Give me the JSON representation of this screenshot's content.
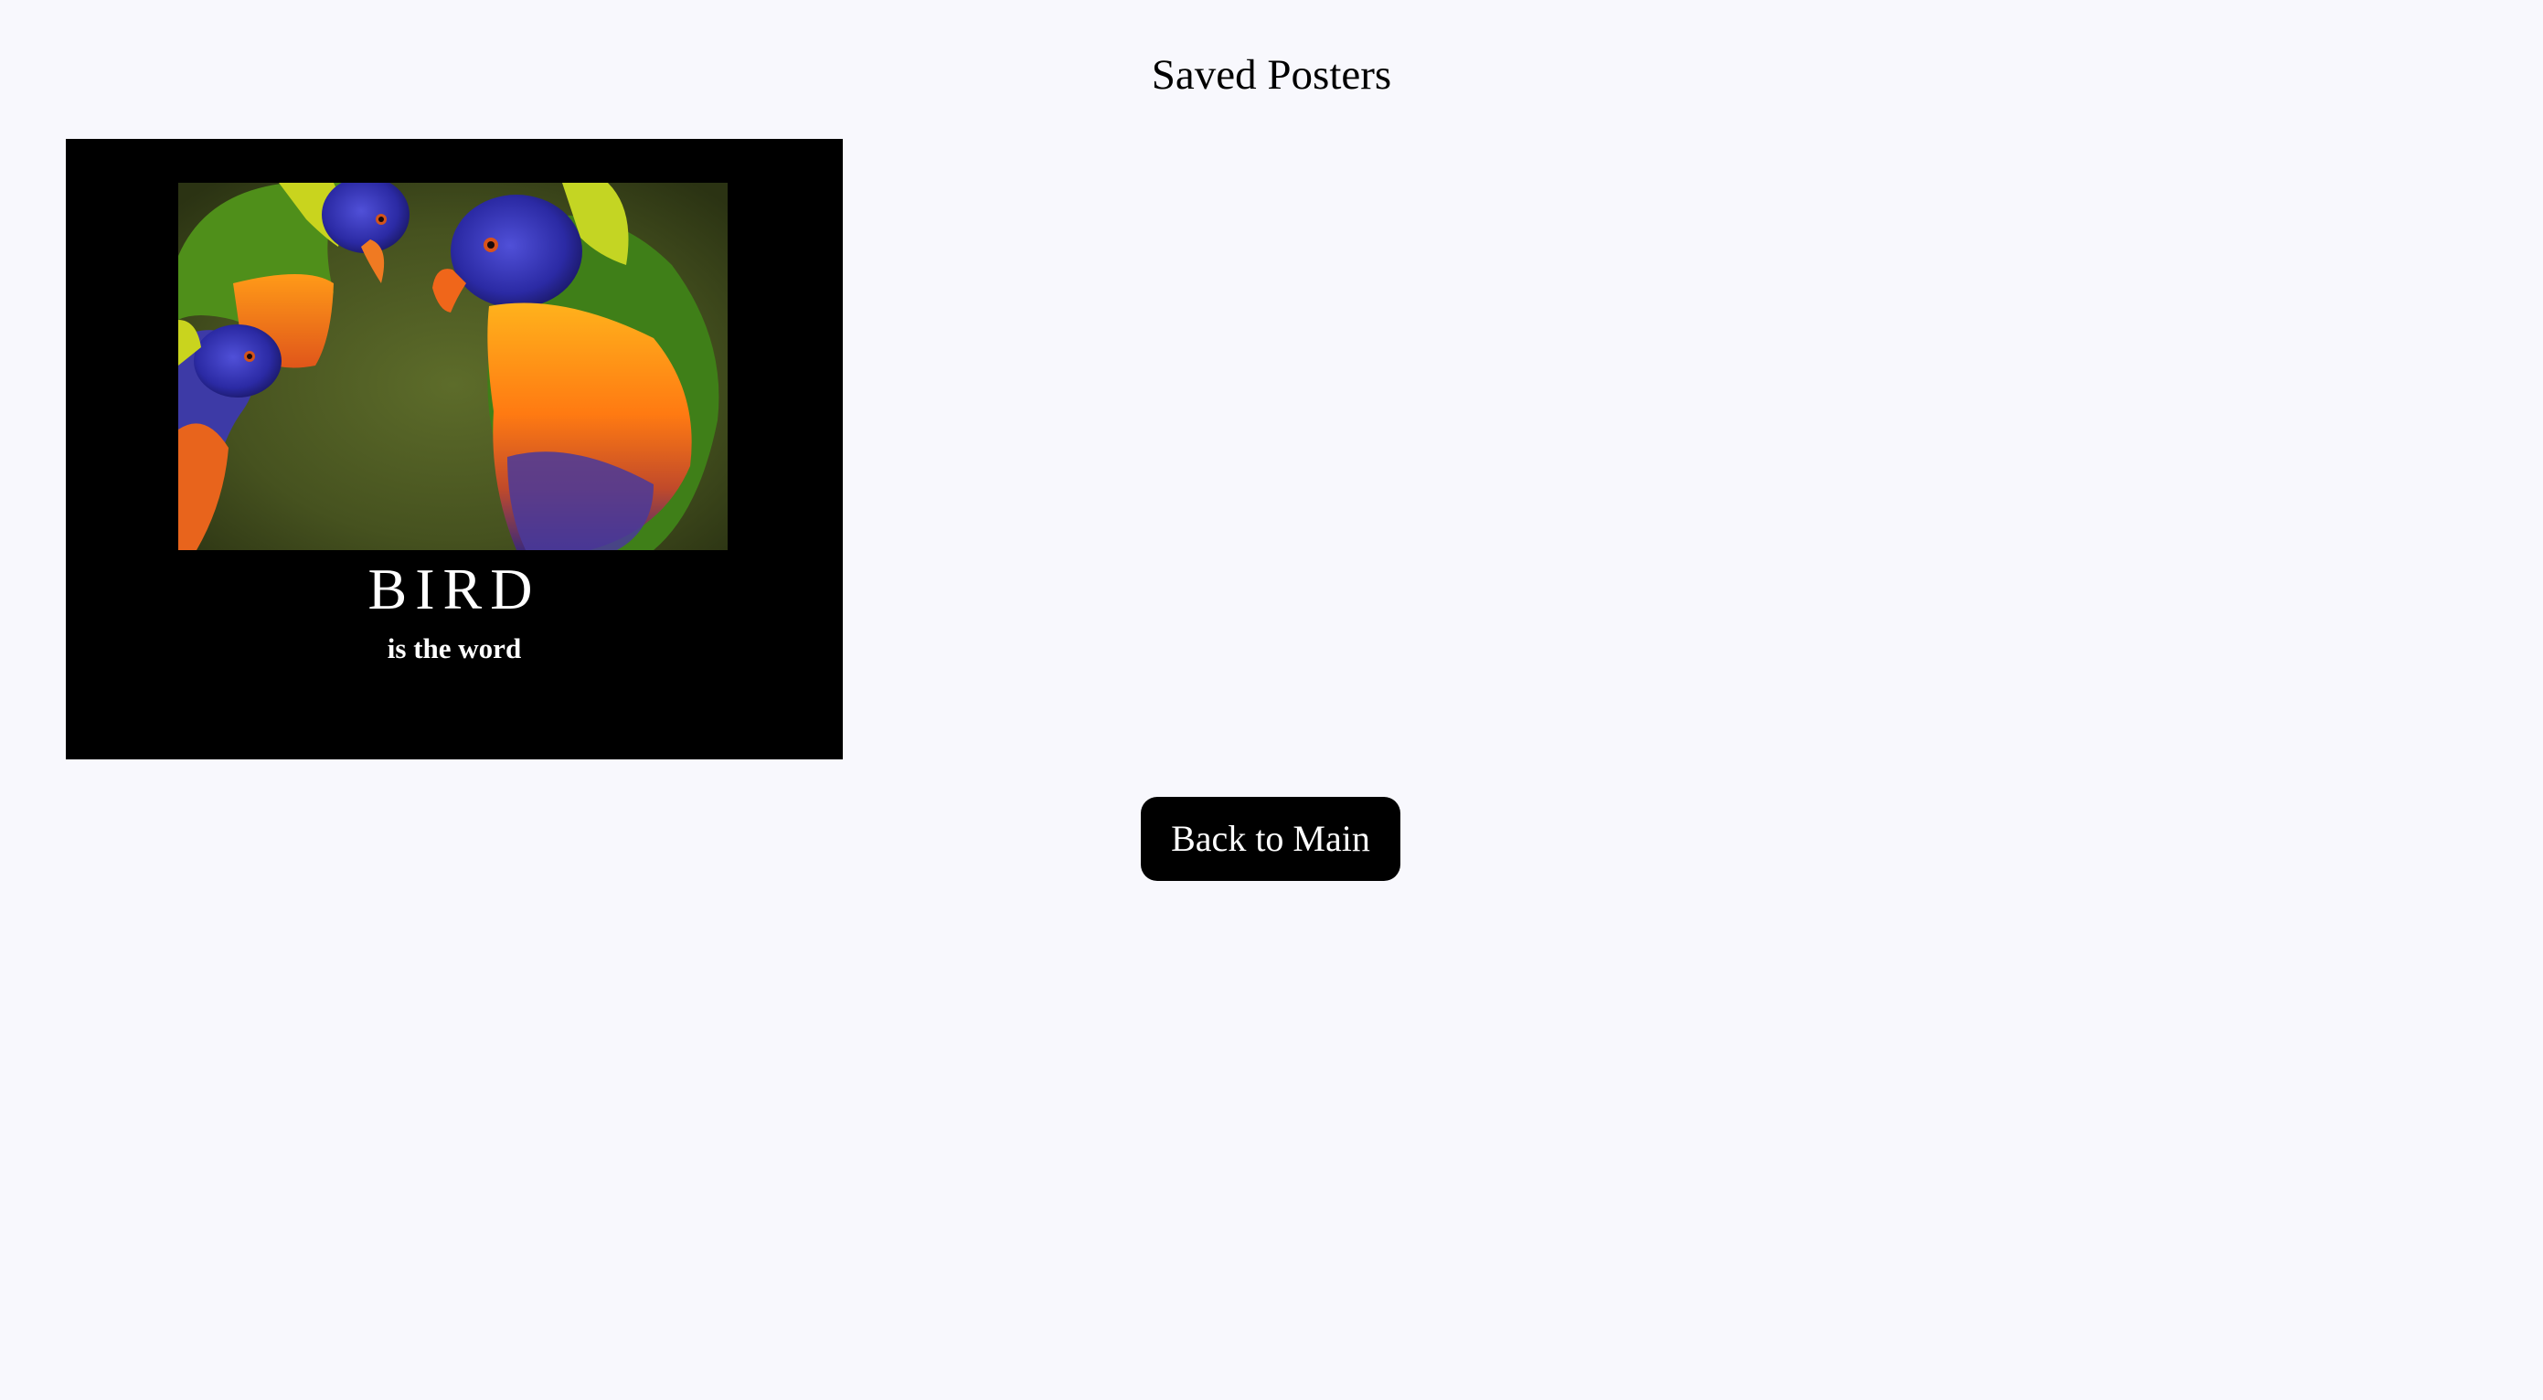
{
  "page": {
    "title": "Saved Posters"
  },
  "saved_posters": [
    {
      "title": "BIRD",
      "quote": "is the word",
      "image_subject": "rainbow lorikeets"
    }
  ],
  "actions": {
    "back_button_label": "Back to Main"
  },
  "colors": {
    "page_background": "#f8f8fd",
    "poster_background": "#000000",
    "button_background": "#000000",
    "button_text": "#ffffff"
  }
}
